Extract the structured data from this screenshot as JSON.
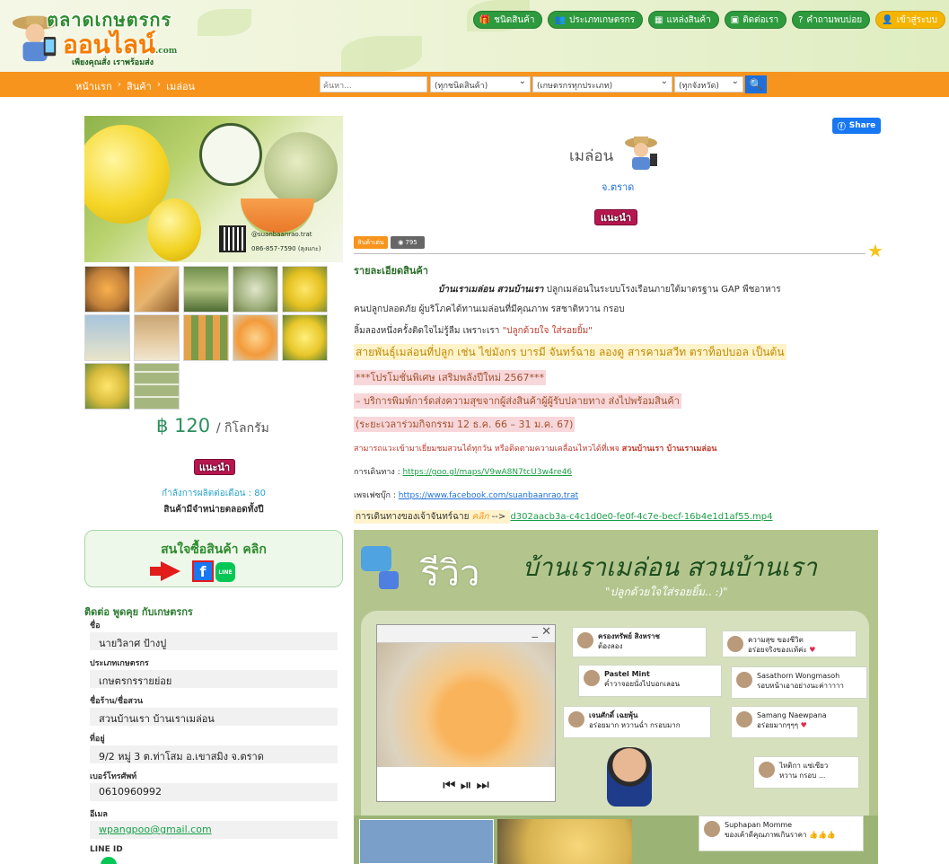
{
  "header": {
    "logo_line1": "ตลาดเกษตรกร",
    "logo_line2": "ออนไลน์",
    "logo_domain": ".com",
    "logo_tagline": "เพียงคุณสั่ง เราพร้อมส่ง",
    "nav": [
      {
        "icon": "gift-icon",
        "label": "ชนิดสินค้า"
      },
      {
        "icon": "users-icon",
        "label": "ประเภทเกษตรกร"
      },
      {
        "icon": "map-icon",
        "label": "แหล่งสินค้า"
      },
      {
        "icon": "contact-icon",
        "label": "ติดต่อเรา"
      },
      {
        "icon": "question-icon",
        "label": "คำถามพบบ่อย"
      },
      {
        "icon": "user-icon",
        "label": "เข้าสู่ระบบ"
      }
    ]
  },
  "toolbar": {
    "breadcrumb": [
      "หน้าแรก",
      "สินค้า",
      "เมล่อน"
    ],
    "search_placeholder": "ค้นหา...",
    "select_type": "(ทุกชนิดสินค้า)",
    "select_farmer": "(เกษตรกรทุกประเภท)",
    "select_province": "(ทุกจังหวัด)"
  },
  "product": {
    "image_contact_handle": "@suanbaanrao.trat",
    "image_contact_phone": "086-857-7590 (ลุงแกะ)",
    "image_logo_text": "บ้านเราเมล่อน สวนบ้านเรา",
    "price_symbol": "฿",
    "price": "120",
    "unit": "/ กิโลกรัม",
    "recommend_badge": "แนะนำ",
    "capacity": "กำลังการผลิตต่อเดือน : 80",
    "availability": "สินค้ามีจำหน่ายตลอดทั้งปี",
    "buy_text": "สนใจซื้อสินค้า คลิก",
    "line_label": "LINE",
    "title": "เมล่อน",
    "province": "จ.ตราด",
    "tag_featured": "สินค้าเด่น",
    "views": "795",
    "share_label": "Share"
  },
  "contact": {
    "heading": "ติดต่อ พูดคุย กับเกษตรกร",
    "fields": [
      {
        "label": "ชื่อ",
        "value": "นายวิลาศ ป้างปู"
      },
      {
        "label": "ประเภทเกษตรกร",
        "value": "เกษตรกรรายย่อย"
      },
      {
        "label": "ชื่อร้าน/ชื่อสวน",
        "value": "สวนบ้านเรา บ้านเราเมล่อน"
      },
      {
        "label": "ที่อยู่",
        "value": "9/2 หมู่ 3 ต.ท่าโสม อ.เขาสมิง จ.ตราด"
      },
      {
        "label": "เบอร์โทรศัพท์",
        "value": "0610960992"
      },
      {
        "label": "อีเมล",
        "value": "wpangpoo@gmail.com"
      },
      {
        "label": "LINE ID",
        "value": ""
      }
    ]
  },
  "details": {
    "heading": "รายละเอียดสินค้า",
    "line1_bold": "บ้านเราเมล่อน สวนบ้านเรา",
    "line1_rest": " ปลูกเมล่อนในระบบโรงเรือนภายใต้มาตรฐาน GAP พืชอาหาร",
    "line2": "คนปลูกปลอดภัย ผู้บริโภคได้ทานเมล่อนที่มีคุณภาพ รสชาติหวาน กรอบ",
    "line3_a": "ลิ้มลองหนึ่งครั้งติดใจไม่รู้ลืม เพราะเรา ",
    "line3_b": "\"ปลูกด้วยใจ ใส่รอยยิ้ม\"",
    "line4": "สายพันธุ์เมล่อนที่ปลูก เช่น ไข่มังกร บารมี จันทร์ฉาย ลองดู สารคามสวีท ตราท็อปบอล เป็นต้น",
    "line5": "***โปรโมชั่นพิเศษ เสริมพลังปีใหม่ 2567***",
    "line6": "– บริการพิมพ์การ์ดส่งความสุขจากผู้ส่งสินค้าผู้ผู้รับปลายทาง ส่งไปพร้อมสินค้า",
    "line7": "(ระยะเวลาร่วมกิจกรรม 12 ธ.ค. 66 – 31 ม.ค. 67)",
    "line8_a": "สามารถแวะเข้ามาเยี่ยมชมสวนได้ทุกวัน หรือติดตามความเคลื่อนไหวได้ที่เพจ ",
    "line8_b": "สวนบ้านเรา บ้านเราเมล่อน",
    "map_label": "การเดินทาง : ",
    "map_link": "https://goo.gl/maps/V9wA8N7tcU3w4re46",
    "fb_label": "เพจเฟซบุ๊ก : ",
    "fb_link": "https://www.facebook.com/suanbaanrao.trat",
    "route_label": "การเดินทางของเจ้าจันทร์ฉาย ",
    "route_click": "คลิก",
    "route_arrow": " --> ",
    "route_file": "d302aacb3a-c4c1d0e0-fe0f-4c7e-becf-16b4e1d1af55.mp4"
  },
  "review_image": {
    "title": "รีวิว",
    "subtitle": "บ้านเราเมล่อน สวนบ้านเรา",
    "quote": "\"ปลูกด้วยใจใส่รอยยิ้ม.. :)\"",
    "comments": [
      {
        "name": "ครองทรัพย์ สิงหราช",
        "text": "ต้องลอง"
      },
      {
        "name": "ความสุข ของชีวิต",
        "text": "อร่อยจริงของแท้ค่ะ"
      },
      {
        "name": "Pastel Mint",
        "text": "ค่ำวาจอยนั่งไปบอกเลอน"
      },
      {
        "name": "Sasathorn Wongmasoh",
        "text": "รอบหน้าเอาอย่างนะค่าาาาา"
      },
      {
        "name": "เจนศักดิ์ เฉยพุ้น",
        "text": "อร่อยมาก หวานฉ่ำ กรอบมาก"
      },
      {
        "name": "Samang Naewpana",
        "text": "อร่อยมากๆๆๆ"
      },
      {
        "name": "ไหติกา แซ่เซียว",
        "text": "หวาน กรอบ ..."
      },
      {
        "name": "Suphapan Momme",
        "text": "ของเค้าดีคุณภาพเกินราคา"
      }
    ]
  }
}
